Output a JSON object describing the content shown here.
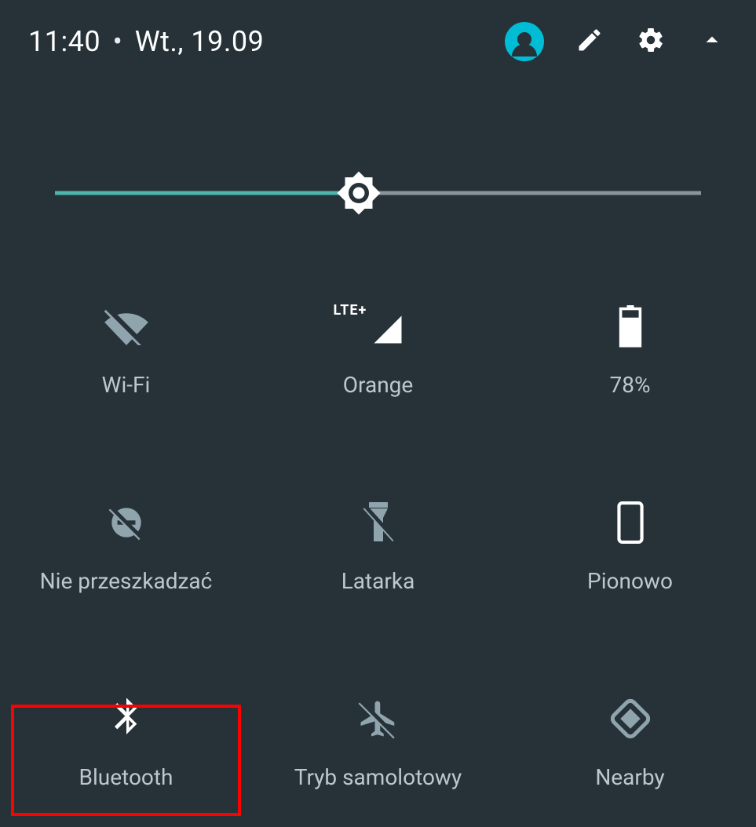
{
  "status": {
    "time": "11:40",
    "sep": "•",
    "date": "Wt., 19.09"
  },
  "brightness": {
    "percent": 47
  },
  "signal": {
    "lte": "LTE+"
  },
  "tiles": {
    "wifi": {
      "label": "Wi-Fi"
    },
    "cellular": {
      "label": "Orange"
    },
    "battery": {
      "label": "78%"
    },
    "dnd": {
      "label": "Nie przeszkadzać"
    },
    "flashlight": {
      "label": "Latarka"
    },
    "rotation": {
      "label": "Pionowo"
    },
    "bluetooth": {
      "label": "Bluetooth"
    },
    "airplane": {
      "label": "Tryb samolotowy"
    },
    "nearby": {
      "label": "Nearby"
    }
  }
}
